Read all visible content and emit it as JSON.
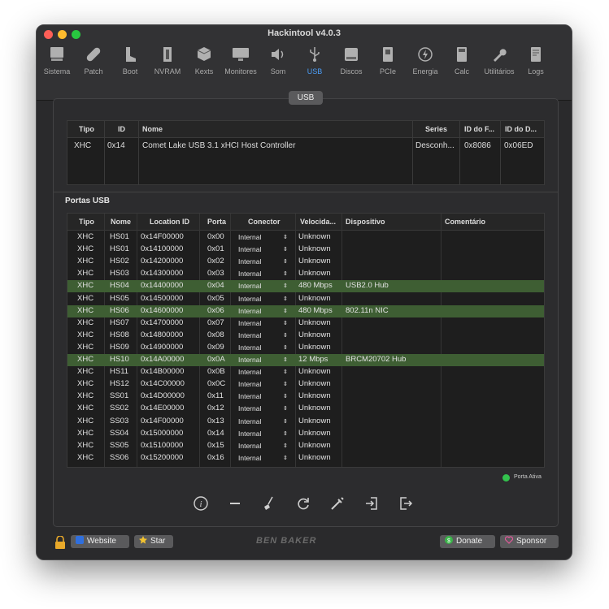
{
  "window": {
    "title": "Hackintool v4.0.3"
  },
  "toolbar": {
    "items": [
      {
        "label": "Sistema",
        "icon": "computer-icon"
      },
      {
        "label": "Patch",
        "icon": "bandage-icon"
      },
      {
        "label": "Boot",
        "icon": "boot-icon"
      },
      {
        "label": "NVRAM",
        "icon": "memory-icon"
      },
      {
        "label": "Kexts",
        "icon": "box-icon"
      },
      {
        "label": "Monitores",
        "icon": "monitor-icon"
      },
      {
        "label": "Som",
        "icon": "speaker-icon"
      },
      {
        "label": "USB",
        "icon": "usb-icon"
      },
      {
        "label": "Discos",
        "icon": "disk-icon"
      },
      {
        "label": "PCIe",
        "icon": "pcie-icon"
      },
      {
        "label": "Energia",
        "icon": "bolt-icon"
      },
      {
        "label": "Calc",
        "icon": "calculator-icon"
      },
      {
        "label": "Utilitários",
        "icon": "wrench-icon"
      },
      {
        "label": "Logs",
        "icon": "log-icon"
      }
    ],
    "active": "USB"
  },
  "panel": {
    "tab_label": "USB"
  },
  "controllers": {
    "headers": [
      "Tipo",
      "ID",
      "Nome",
      "Series",
      "ID do F...",
      "ID do D..."
    ],
    "rows": [
      [
        "XHC",
        "0x14",
        "Comet Lake USB 3.1 xHCI Host Controller",
        "Desconh...",
        "0x8086",
        "0x06ED"
      ]
    ]
  },
  "ports_section": {
    "title": "Portas USB"
  },
  "ports": {
    "headers": [
      "Tipo",
      "Nome",
      "Location ID",
      "Porta",
      "Conector",
      "Velocida...",
      "Dispositivo",
      "Comentário"
    ],
    "rows": [
      {
        "tipo": "XHC",
        "nome": "HS01",
        "loc": "0x14F00000",
        "porta": "0x00",
        "conector": "Internal",
        "vel": "Unknown",
        "disp": "",
        "active": false
      },
      {
        "tipo": "XHC",
        "nome": "HS01",
        "loc": "0x14100000",
        "porta": "0x01",
        "conector": "Internal",
        "vel": "Unknown",
        "disp": "",
        "active": false
      },
      {
        "tipo": "XHC",
        "nome": "HS02",
        "loc": "0x14200000",
        "porta": "0x02",
        "conector": "Internal",
        "vel": "Unknown",
        "disp": "",
        "active": false
      },
      {
        "tipo": "XHC",
        "nome": "HS03",
        "loc": "0x14300000",
        "porta": "0x03",
        "conector": "Internal",
        "vel": "Unknown",
        "disp": "",
        "active": false
      },
      {
        "tipo": "XHC",
        "nome": "HS04",
        "loc": "0x14400000",
        "porta": "0x04",
        "conector": "Internal",
        "vel": "480 Mbps",
        "disp": "USB2.0 Hub",
        "active": true
      },
      {
        "tipo": "XHC",
        "nome": "HS05",
        "loc": "0x14500000",
        "porta": "0x05",
        "conector": "Internal",
        "vel": "Unknown",
        "disp": "",
        "active": false
      },
      {
        "tipo": "XHC",
        "nome": "HS06",
        "loc": "0x14600000",
        "porta": "0x06",
        "conector": "Internal",
        "vel": "480 Mbps",
        "disp": "802.11n NIC",
        "active": true
      },
      {
        "tipo": "XHC",
        "nome": "HS07",
        "loc": "0x14700000",
        "porta": "0x07",
        "conector": "Internal",
        "vel": "Unknown",
        "disp": "",
        "active": false
      },
      {
        "tipo": "XHC",
        "nome": "HS08",
        "loc": "0x14800000",
        "porta": "0x08",
        "conector": "Internal",
        "vel": "Unknown",
        "disp": "",
        "active": false
      },
      {
        "tipo": "XHC",
        "nome": "HS09",
        "loc": "0x14900000",
        "porta": "0x09",
        "conector": "Internal",
        "vel": "Unknown",
        "disp": "",
        "active": false
      },
      {
        "tipo": "XHC",
        "nome": "HS10",
        "loc": "0x14A00000",
        "porta": "0x0A",
        "conector": "Internal",
        "vel": "12 Mbps",
        "disp": "BRCM20702 Hub",
        "active": true
      },
      {
        "tipo": "XHC",
        "nome": "HS11",
        "loc": "0x14B00000",
        "porta": "0x0B",
        "conector": "Internal",
        "vel": "Unknown",
        "disp": "",
        "active": false
      },
      {
        "tipo": "XHC",
        "nome": "HS12",
        "loc": "0x14C00000",
        "porta": "0x0C",
        "conector": "Internal",
        "vel": "Unknown",
        "disp": "",
        "active": false
      },
      {
        "tipo": "XHC",
        "nome": "SS01",
        "loc": "0x14D00000",
        "porta": "0x11",
        "conector": "Internal",
        "vel": "Unknown",
        "disp": "",
        "active": false
      },
      {
        "tipo": "XHC",
        "nome": "SS02",
        "loc": "0x14E00000",
        "porta": "0x12",
        "conector": "Internal",
        "vel": "Unknown",
        "disp": "",
        "active": false
      },
      {
        "tipo": "XHC",
        "nome": "SS03",
        "loc": "0x14F00000",
        "porta": "0x13",
        "conector": "Internal",
        "vel": "Unknown",
        "disp": "",
        "active": false
      },
      {
        "tipo": "XHC",
        "nome": "SS04",
        "loc": "0x15000000",
        "porta": "0x14",
        "conector": "Internal",
        "vel": "Unknown",
        "disp": "",
        "active": false
      },
      {
        "tipo": "XHC",
        "nome": "SS05",
        "loc": "0x15100000",
        "porta": "0x15",
        "conector": "Internal",
        "vel": "Unknown",
        "disp": "",
        "active": false
      },
      {
        "tipo": "XHC",
        "nome": "SS06",
        "loc": "0x15200000",
        "porta": "0x16",
        "conector": "Internal",
        "vel": "Unknown",
        "disp": "",
        "active": false
      }
    ]
  },
  "legend": {
    "label": "Porta Ativa",
    "color": "#33c24d"
  },
  "actions": [
    {
      "name": "info-button",
      "icon": "info-icon"
    },
    {
      "name": "remove-button",
      "icon": "minus-icon"
    },
    {
      "name": "clear-button",
      "icon": "broom-icon"
    },
    {
      "name": "refresh-button",
      "icon": "refresh-icon"
    },
    {
      "name": "inject-button",
      "icon": "syringe-icon"
    },
    {
      "name": "import-button",
      "icon": "import-icon"
    },
    {
      "name": "export-button",
      "icon": "export-icon"
    }
  ],
  "bottom": {
    "website_label": "Website",
    "star_label": "Star",
    "brand": "BEN BAKER",
    "donate_label": "Donate",
    "sponsor_label": "Sponsor"
  },
  "colors": {
    "active_row": "#3e5e33",
    "accent": "#4a9df7",
    "window_bg": "#2a2a2c"
  }
}
